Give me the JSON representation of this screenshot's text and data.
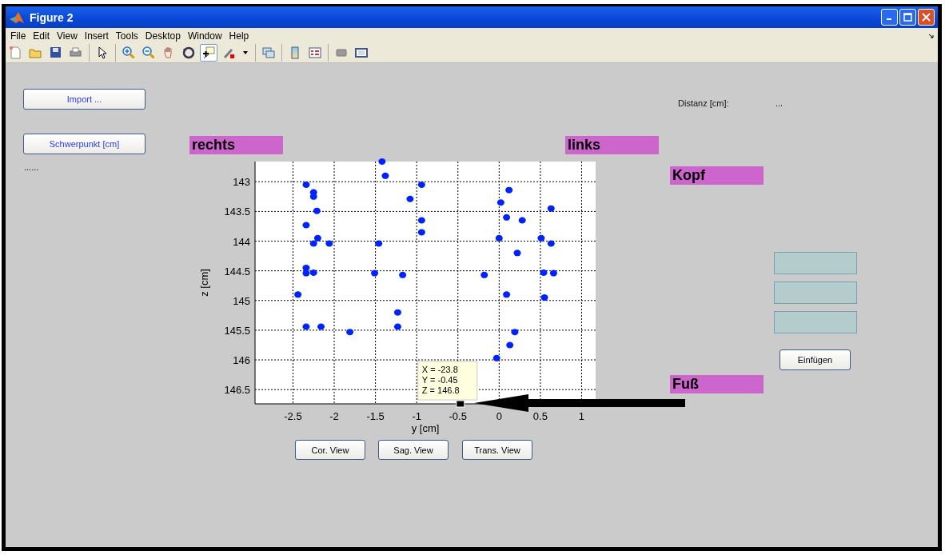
{
  "window": {
    "title": "Figure 2"
  },
  "menu": [
    "File",
    "Edit",
    "View",
    "Insert",
    "Tools",
    "Desktop",
    "Window",
    "Help"
  ],
  "toolbar": {
    "groups": [
      [
        {
          "kind": "new",
          "pressed": false
        },
        {
          "kind": "open",
          "pressed": false
        },
        {
          "kind": "save",
          "pressed": false
        },
        {
          "kind": "print",
          "pressed": false
        }
      ],
      [
        {
          "kind": "pointer",
          "pressed": false
        }
      ],
      [
        {
          "kind": "zoomin",
          "pressed": false
        },
        {
          "kind": "zoomout",
          "pressed": false
        },
        {
          "kind": "pan",
          "pressed": false
        },
        {
          "kind": "rotate",
          "pressed": false
        },
        {
          "kind": "datacursor",
          "pressed": true
        },
        {
          "kind": "brush",
          "pressed": false
        },
        {
          "kind": "caret",
          "pressed": false
        }
      ],
      [
        {
          "kind": "link",
          "pressed": false
        }
      ],
      [
        {
          "kind": "colorbar",
          "pressed": false
        },
        {
          "kind": "legend",
          "pressed": false
        }
      ],
      [
        {
          "kind": "hide",
          "pressed": false
        },
        {
          "kind": "show",
          "pressed": false
        }
      ]
    ]
  },
  "left_panel": {
    "import_button": "Import ...",
    "centroid_button": "Schwerpunkt [cm]",
    "centroid_value": "......"
  },
  "labels": {
    "right": "rechts",
    "left": "links",
    "head": "Kopf",
    "foot": "Fuß"
  },
  "distance": {
    "label": "Distanz [cm]:",
    "value": "..."
  },
  "fields": [
    {
      "kind": "edit"
    },
    {
      "kind": "edit"
    },
    {
      "kind": "edit"
    }
  ],
  "insert_button": "Einfügen",
  "view_buttons": [
    "Cor. View",
    "Sag. View",
    "Trans. View"
  ],
  "plot": {
    "chart_data": {
      "type": "scatter",
      "xlabel": "y [cm]",
      "ylabel": "z [cm]",
      "xlim": [
        -2.96,
        1.17
      ],
      "ylim": [
        146.74,
        142.66
      ],
      "grid": true,
      "xticks": [
        -2.5,
        -2,
        -1.5,
        -1,
        -0.5,
        0,
        0.5,
        1
      ],
      "yticks": [
        143,
        143.5,
        144,
        144.5,
        145,
        145.5,
        146,
        146.5
      ],
      "series": [
        {
          "color": "#0022ff",
          "x": [
            -1.42,
            -1.38,
            -2.34,
            -0.94,
            0.12,
            -2.25,
            -2.25,
            -1.08,
            0.02,
            0.63,
            -2.21,
            0.09,
            0.28,
            -0.94,
            -2.34,
            -0.94,
            0.0,
            0.51,
            -2.2,
            -2.25,
            -2.06,
            -1.46,
            0.63,
            0.22,
            -2.34,
            -2.34,
            -2.25,
            -1.51,
            -1.17,
            -0.18,
            0.54,
            0.66,
            -2.44,
            0.09,
            0.55,
            -1.23,
            -2.34,
            -2.16,
            -1.23,
            -1.81,
            0.19,
            0.13,
            -0.03
          ],
          "values": [
            142.66,
            142.9,
            143.05,
            143.05,
            143.14,
            143.18,
            143.25,
            143.29,
            143.35,
            143.45,
            143.49,
            143.6,
            143.65,
            143.65,
            143.73,
            143.85,
            143.95,
            143.95,
            143.95,
            144.04,
            144.04,
            144.04,
            144.04,
            144.2,
            144.45,
            144.54,
            144.53,
            144.54,
            144.57,
            144.57,
            144.53,
            144.54,
            144.9,
            144.9,
            144.95,
            145.2,
            145.44,
            145.44,
            145.44,
            145.53,
            145.53,
            145.75,
            145.97
          ]
        }
      ],
      "annotations": [
        {
          "x": -0.47,
          "y": 146.74,
          "text": "X = -23.8\nY = -0.45\nZ = 146.8"
        }
      ]
    }
  }
}
